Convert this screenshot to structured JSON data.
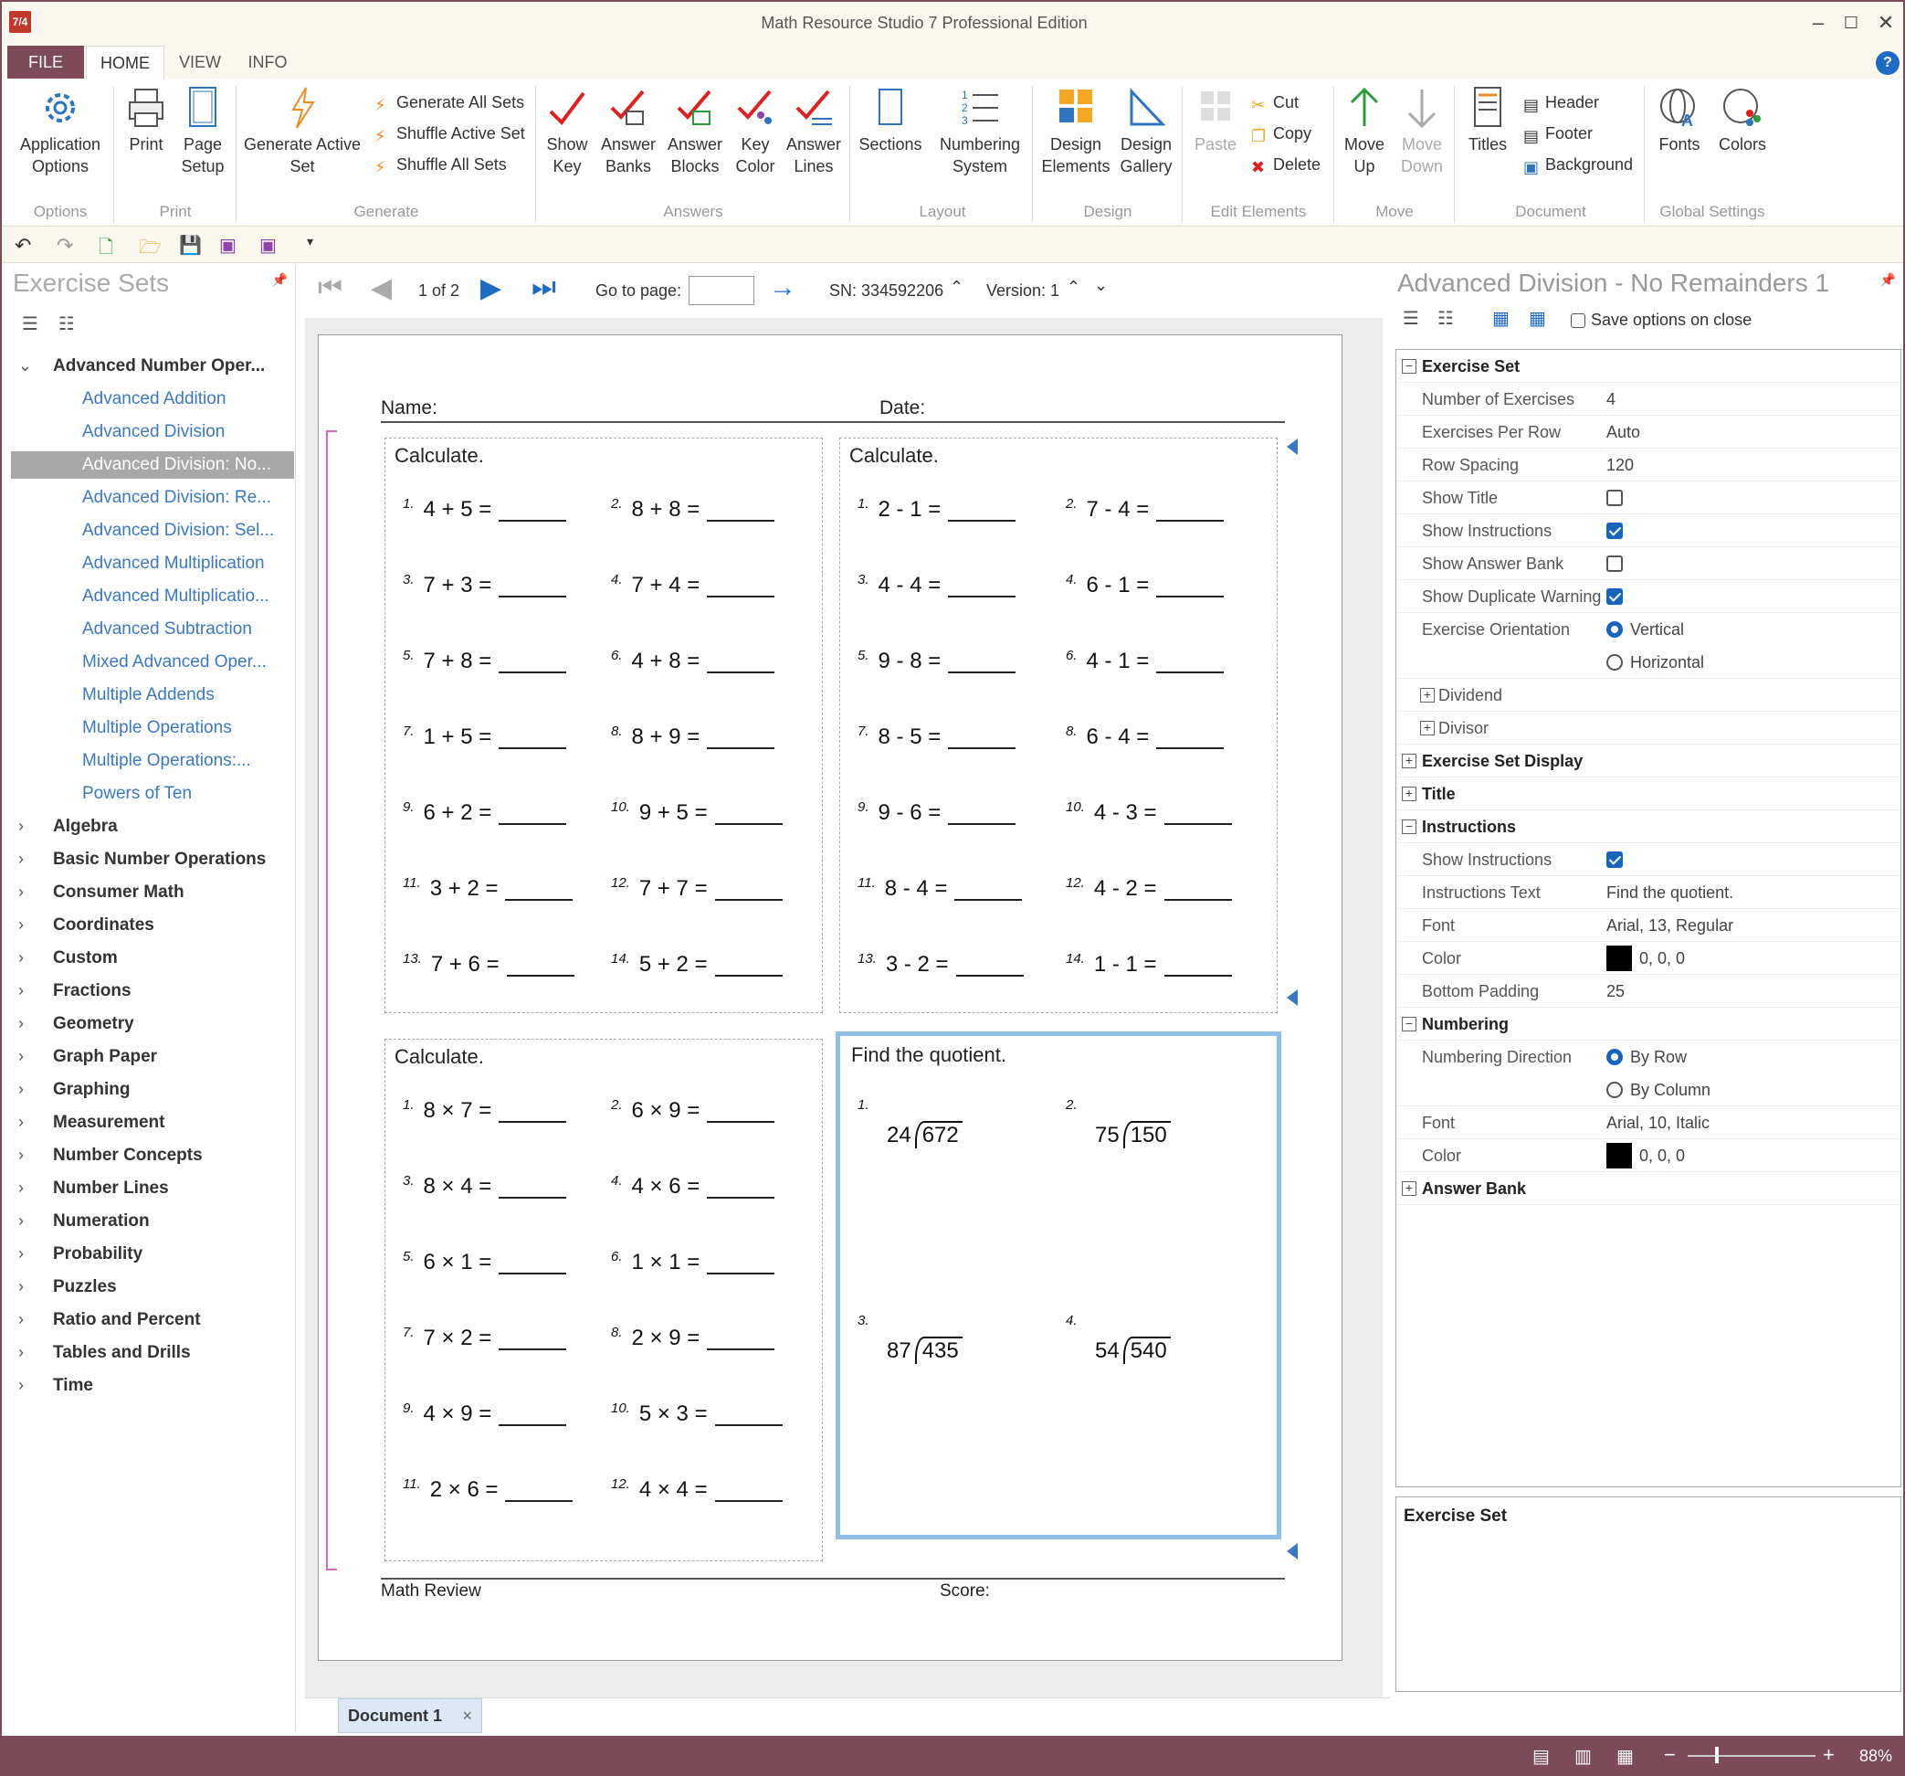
{
  "window": {
    "title": "Math Resource Studio 7 Professional Edition",
    "icon_text": "7/4"
  },
  "ribbon_tabs": [
    "FILE",
    "HOME",
    "VIEW",
    "INFO"
  ],
  "ribbon": {
    "application_options": "Application Options",
    "print": "Print",
    "page_setup": "Page Setup",
    "generate_active_set": "Generate Active Set",
    "generate_all_sets": "Generate All Sets",
    "shuffle_active_set": "Shuffle Active Set",
    "shuffle_all_sets": "Shuffle All Sets",
    "show_key": "Show Key",
    "answer_banks": "Answer Banks",
    "answer_blocks": "Answer Blocks",
    "key_color": "Key Color",
    "answer_lines": "Answer Lines",
    "sections": "Sections",
    "numbering_system": "Numbering System",
    "design_elements": "Design Elements",
    "design_gallery": "Design Gallery",
    "paste": "Paste",
    "cut": "Cut",
    "copy": "Copy",
    "delete": "Delete",
    "move_up": "Move Up",
    "move_down": "Move Down",
    "titles": "Titles",
    "header": "Header",
    "footer": "Footer",
    "background": "Background",
    "fonts": "Fonts",
    "colors": "Colors",
    "groups": {
      "options": "Options",
      "print": "Print",
      "generate": "Generate",
      "answers": "Answers",
      "layout": "Layout",
      "design": "Design",
      "edit_elements": "Edit Elements",
      "move": "Move",
      "document": "Document",
      "global_settings": "Global Settings"
    }
  },
  "left_panel": {
    "title": "Exercise Sets",
    "expanded_category": "Advanced Number Oper...",
    "sub_items": [
      "Advanced Addition",
      "Advanced Division",
      "Advanced Division: No...",
      "Advanced Division: Re...",
      "Advanced Division: Sel...",
      "Advanced Multiplication",
      "Advanced Multiplicatio...",
      "Advanced Subtraction",
      "Mixed Advanced Oper...",
      "Multiple Addends",
      "Multiple Operations",
      "Multiple Operations:...",
      "Powers of Ten"
    ],
    "selected_index": 2,
    "categories": [
      "Algebra",
      "Basic Number Operations",
      "Consumer Math",
      "Coordinates",
      "Custom",
      "Fractions",
      "Geometry",
      "Graph Paper",
      "Graphing",
      "Measurement",
      "Number Concepts",
      "Number Lines",
      "Numeration",
      "Probability",
      "Puzzles",
      "Ratio and Percent",
      "Tables and Drills",
      "Time"
    ]
  },
  "navbar": {
    "page": "1 of 2",
    "goto_label": "Go to page:",
    "sn": "SN: 334592206",
    "version": "Version: 1"
  },
  "worksheet": {
    "name_label": "Name:",
    "date_label": "Date:",
    "footer_left": "Math Review",
    "footer_right": "Score:",
    "box1": {
      "instruction": "Calculate.",
      "items": [
        [
          "1.",
          "4 + 5 ="
        ],
        [
          "2.",
          "8 + 8 ="
        ],
        [
          "3.",
          "7 + 3 ="
        ],
        [
          "4.",
          "7 + 4 ="
        ],
        [
          "5.",
          "7 + 8 ="
        ],
        [
          "6.",
          "4 + 8 ="
        ],
        [
          "7.",
          "1 + 5 ="
        ],
        [
          "8.",
          "8 + 9 ="
        ],
        [
          "9.",
          "6 + 2 ="
        ],
        [
          "10.",
          "9 + 5 ="
        ],
        [
          "11.",
          "3 + 2 ="
        ],
        [
          "12.",
          "7 + 7 ="
        ],
        [
          "13.",
          "7 + 6 ="
        ],
        [
          "14.",
          "5 + 2 ="
        ]
      ]
    },
    "box2": {
      "instruction": "Calculate.",
      "items": [
        [
          "1.",
          "2 - 1 ="
        ],
        [
          "2.",
          "7 - 4 ="
        ],
        [
          "3.",
          "4 - 4 ="
        ],
        [
          "4.",
          "6 - 1 ="
        ],
        [
          "5.",
          "9 - 8 ="
        ],
        [
          "6.",
          "4 - 1 ="
        ],
        [
          "7.",
          "8 - 5 ="
        ],
        [
          "8.",
          "6 - 4 ="
        ],
        [
          "9.",
          "9 - 6 ="
        ],
        [
          "10.",
          "4 - 3 ="
        ],
        [
          "11.",
          "8 - 4 ="
        ],
        [
          "12.",
          "4 - 2 ="
        ],
        [
          "13.",
          "3 - 2 ="
        ],
        [
          "14.",
          "1 - 1 ="
        ]
      ]
    },
    "box3": {
      "instruction": "Calculate.",
      "items": [
        [
          "1.",
          "8 × 7 ="
        ],
        [
          "2.",
          "6 × 9 ="
        ],
        [
          "3.",
          "8 × 4 ="
        ],
        [
          "4.",
          "4 × 6 ="
        ],
        [
          "5.",
          "6 × 1 ="
        ],
        [
          "6.",
          "1 × 1 ="
        ],
        [
          "7.",
          "7 × 2 ="
        ],
        [
          "8.",
          "2 × 9 ="
        ],
        [
          "9.",
          "4 × 9 ="
        ],
        [
          "10.",
          "5 × 3 ="
        ],
        [
          "11.",
          "2 × 6 ="
        ],
        [
          "12.",
          "4 × 4 ="
        ]
      ]
    },
    "box4": {
      "instruction": "Find the quotient.",
      "items": [
        [
          "1.",
          "24",
          "672"
        ],
        [
          "2.",
          "75",
          "150"
        ],
        [
          "3.",
          "87",
          "435"
        ],
        [
          "4.",
          "54",
          "540"
        ]
      ]
    }
  },
  "doc_tab": "Document 1",
  "right_panel": {
    "title": "Advanced Division - No Remainders 1",
    "save_options": "Save options on close",
    "exercise_set": "Exercise Set",
    "number_of_exercises": [
      "Number of Exercises",
      "4"
    ],
    "exercises_per_row": [
      "Exercises Per Row",
      "Auto"
    ],
    "row_spacing": [
      "Row Spacing",
      "120"
    ],
    "show_title": "Show Title",
    "show_instructions": "Show Instructions",
    "show_answer_bank": "Show Answer Bank",
    "show_duplicate_warning": "Show Duplicate Warning",
    "exercise_orientation": "Exercise Orientation",
    "vertical": "Vertical",
    "horizontal": "Horizontal",
    "dividend": "Dividend",
    "divisor": "Divisor",
    "exercise_set_display": "Exercise Set Display",
    "title_sec": "Title",
    "instructions_sec": "Instructions",
    "instr_show": "Show Instructions",
    "instructions_text": [
      "Instructions Text",
      "Find the quotient."
    ],
    "font1": [
      "Font",
      "Arial, 13, Regular"
    ],
    "color1": [
      "Color",
      "0, 0, 0"
    ],
    "bottom_padding": [
      "Bottom Padding",
      "25"
    ],
    "numbering_sec": "Numbering",
    "numbering_direction": "Numbering Direction",
    "by_row": "By Row",
    "by_column": "By Column",
    "font2": [
      "Font",
      "Arial, 10, Italic"
    ],
    "color2": [
      "Color",
      "0, 0, 0"
    ],
    "answer_bank": "Answer Bank",
    "desc_title": "Exercise Set"
  },
  "status": {
    "zoom": "88%"
  }
}
